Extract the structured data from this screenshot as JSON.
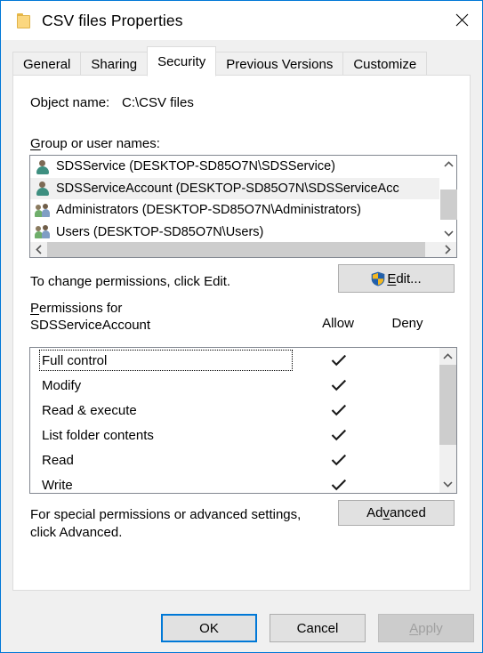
{
  "window": {
    "title": "CSV files Properties",
    "folder_icon": "folder-icon",
    "close_icon": "close-icon"
  },
  "tabs": [
    {
      "label": "General",
      "active": false
    },
    {
      "label": "Sharing",
      "active": false
    },
    {
      "label": "Security",
      "active": true
    },
    {
      "label": "Previous Versions",
      "active": false
    },
    {
      "label": "Customize",
      "active": false
    }
  ],
  "security": {
    "object_name_label": "Object name:",
    "object_name_value": "C:\\CSV files",
    "group_label_accel": "G",
    "group_label_rest": "roup or user names:",
    "group_users": [
      {
        "name": "SDSService (DESKTOP-SD85O7N\\SDSService)",
        "icon": "user-icon",
        "selected": false
      },
      {
        "name": "SDSServiceAccount (DESKTOP-SD85O7N\\SDSServiceAcc",
        "icon": "user-icon",
        "selected": true
      },
      {
        "name": "Administrators (DESKTOP-SD85O7N\\Administrators)",
        "icon": "user-group-icon",
        "selected": false
      },
      {
        "name": "Users (DESKTOP-SD85O7N\\Users)",
        "icon": "user-group-icon",
        "selected": false
      }
    ],
    "edit_hint": "To change permissions, click Edit.",
    "edit_button_accel": "E",
    "edit_button_rest": "dit...",
    "edit_button_shield": "uac-shield-icon",
    "perm_label_accel": "P",
    "perm_label_rest": "ermissions for",
    "perm_label_subject": "SDSServiceAccount",
    "columns": {
      "allow": "Allow",
      "deny": "Deny"
    },
    "permissions": [
      {
        "name": "Full control",
        "allow": true,
        "deny": false,
        "focused": true
      },
      {
        "name": "Modify",
        "allow": true,
        "deny": false,
        "focused": false
      },
      {
        "name": "Read & execute",
        "allow": true,
        "deny": false,
        "focused": false
      },
      {
        "name": "List folder contents",
        "allow": true,
        "deny": false,
        "focused": false
      },
      {
        "name": "Read",
        "allow": true,
        "deny": false,
        "focused": false
      },
      {
        "name": "Write",
        "allow": true,
        "deny": false,
        "focused": false
      }
    ],
    "advanced_hint_line1": "For special permissions or advanced settings,",
    "advanced_hint_line2": "click Advanced.",
    "advanced_button_pre": "Ad",
    "advanced_button_accel": "v",
    "advanced_button_rest": "anced"
  },
  "footer": {
    "ok": "OK",
    "cancel": "Cancel",
    "apply_accel": "A",
    "apply_rest": "pply",
    "apply_disabled": true
  },
  "colors": {
    "dialog_border": "#0078d7",
    "focus_border": "#0078d7",
    "dialog_bg": "#f0f0f0",
    "panel_bg": "#ffffff",
    "button_bg": "#e1e1e1",
    "scroll_thumb": "#cdcdcd",
    "selection_bg": "#f0f0f0",
    "disabled_text": "#a0a0a0"
  }
}
